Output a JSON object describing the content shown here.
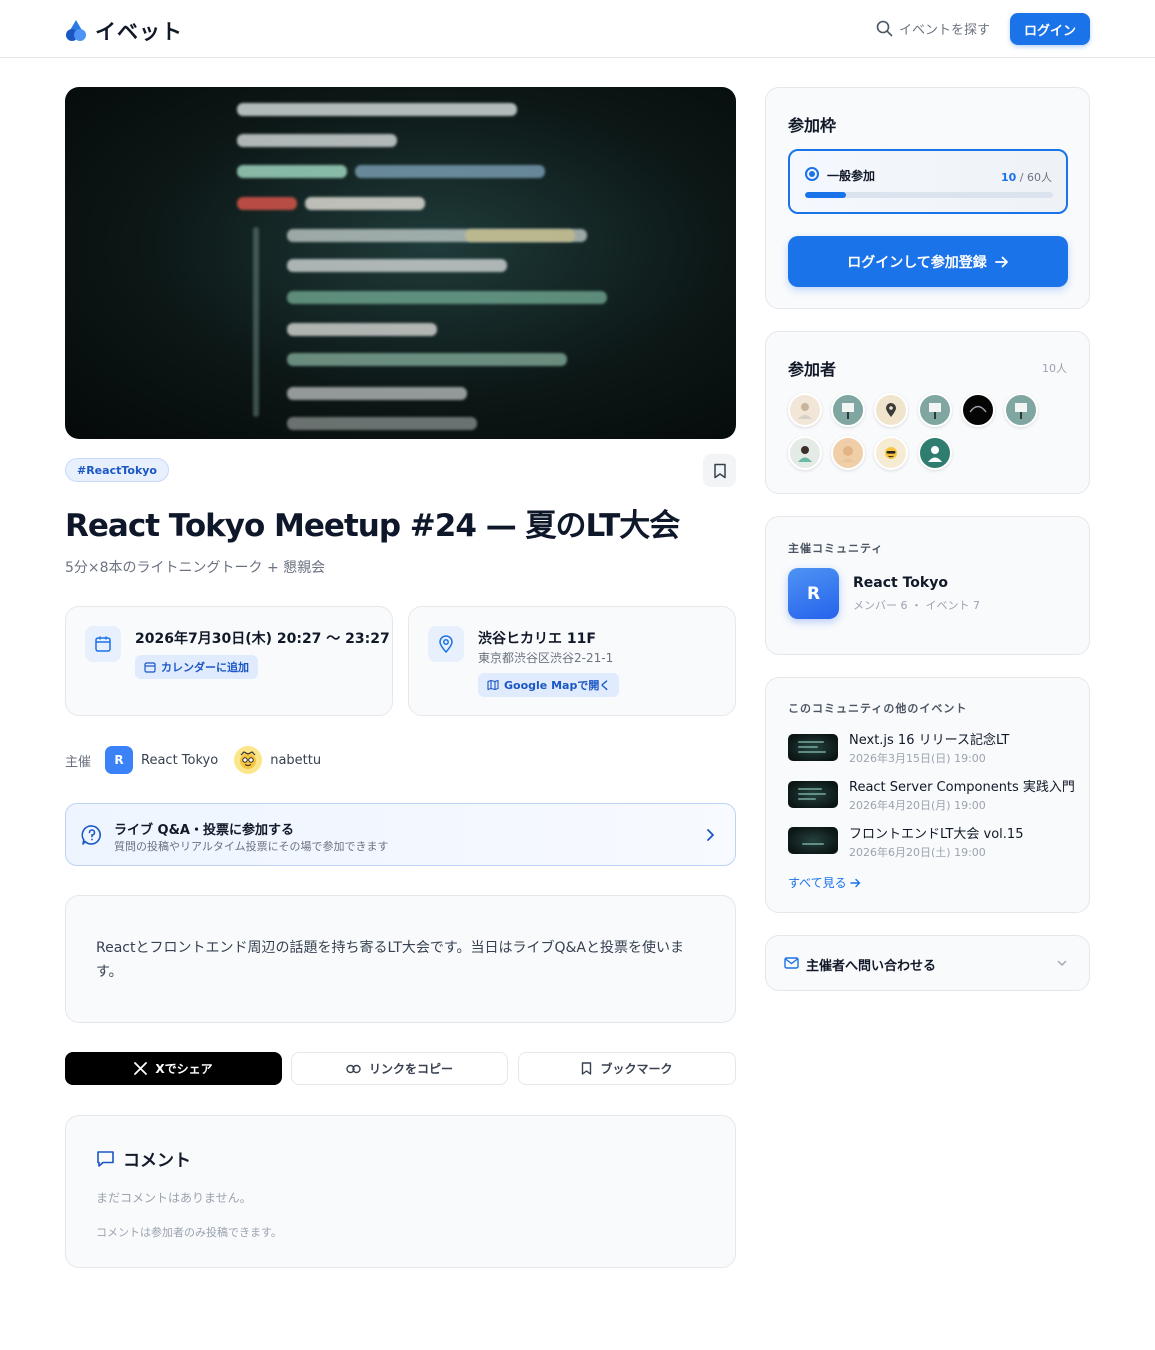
{
  "header": {
    "app_name": "イベット",
    "search_label": "イベントを探す",
    "login_label": "ログイン"
  },
  "event": {
    "tag": "#ReactTokyo",
    "title": "React Tokyo Meetup #24 — 夏のLT大会",
    "subtitle": "5分×8本のライトニングトーク + 懇親会",
    "datetime": "2026年7月30日(木) 20:27 〜 23:27",
    "calendar_button": "カレンダーに追加",
    "venue_name": "渋谷ヒカリエ 11F",
    "venue_address": "東京都渋谷区渋谷2-21-1",
    "map_button": "Google Mapで開く",
    "host_label": "主催",
    "host_community": "React Tokyo",
    "host_community_initial": "R",
    "host_user": "nabettu",
    "qa_title": "ライブ Q&A・投票に参加する",
    "qa_subtitle": "質問の投稿やリアルタイム投票にその場で参加できます",
    "description": "Reactとフロントエンド周辺の話題を持ち寄るLT大会です。当日はライブQ&Aと投票を使います。",
    "share_x": "Xでシェア",
    "share_copy": "リンクをコピー",
    "share_bookmark": "ブックマーク"
  },
  "comments": {
    "title": "コメント",
    "empty": "まだコメントはありません。",
    "note": "コメントは参加者のみ投稿できます。"
  },
  "sidebar": {
    "tickets": {
      "heading": "参加枠",
      "ticket_name": "一般参加",
      "registered": "10",
      "capacity_text": "/ 60人",
      "progress": 0.167,
      "register_button": "ログインして参加登録"
    },
    "attendees": {
      "heading": "参加者",
      "count": "10人",
      "avatars": [
        "person-icon",
        "sign-icon",
        "pin-icon",
        "sign-icon",
        "wave-icon",
        "sign-icon",
        "person-icon",
        "person-icon",
        "face-icon",
        "person-icon"
      ]
    },
    "community": {
      "heading": "主催コミュニティ",
      "initial": "R",
      "name": "React Tokyo",
      "meta": "メンバー 6 ・ イベント 7"
    },
    "other_events": {
      "heading": "このコミュニティの他のイベント",
      "items": [
        {
          "title": "Next.js 16 リリース記念LT",
          "date": "2026年3月15日(日) 19:00"
        },
        {
          "title": "React Server Components 実践入門",
          "date": "2026年4月20日(月) 19:00"
        },
        {
          "title": "フロントエンドLT大会 vol.15",
          "date": "2026年6月20日(土) 19:00"
        }
      ],
      "see_all": "すべて見る"
    },
    "contact": {
      "label": "主催者へ問い合わせる"
    }
  },
  "colors": {
    "accent": "#1a73e8",
    "text": "#0f172a",
    "muted": "#6b7280"
  }
}
